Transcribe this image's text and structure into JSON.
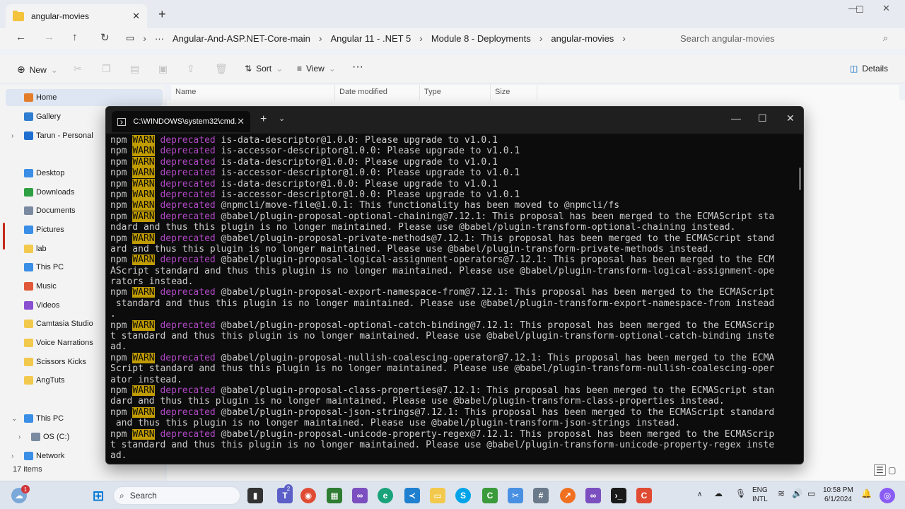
{
  "explorer": {
    "tab_title": "angular-movies",
    "breadcrumbs": [
      "Angular-And-ASP.NET-Core-main",
      "Angular 11 - .NET 5",
      "Module 8 - Deployments",
      "angular-movies"
    ],
    "search_placeholder": "Search angular-movies",
    "commands": {
      "new": "New",
      "sort": "Sort",
      "view": "View",
      "details": "Details"
    },
    "columns": [
      "Name",
      "Date modified",
      "Type",
      "Size"
    ],
    "sidebar": [
      "Home",
      "Gallery",
      "Tarun - Personal",
      "Desktop",
      "Downloads",
      "Documents",
      "Pictures",
      "lab",
      "This PC",
      "Music",
      "Videos",
      "Camtasia Studio",
      "Voice Narrations",
      "Scissors Kicks",
      "AngTuts",
      "This PC",
      "OS (C:)",
      "Network"
    ],
    "status": "17 items"
  },
  "terminal": {
    "tab_title": "C:\\WINDOWS\\system32\\cmd.",
    "lines": [
      [
        "npm",
        "WARN",
        "deprecated",
        " is-data-descriptor@1.0.0: Please upgrade to v1.0.1"
      ],
      [
        "npm",
        "WARN",
        "deprecated",
        " is-accessor-descriptor@1.0.0: Please upgrade to v1.0.1"
      ],
      [
        "npm",
        "WARN",
        "deprecated",
        " is-data-descriptor@1.0.0: Please upgrade to v1.0.1"
      ],
      [
        "npm",
        "WARN",
        "deprecated",
        " is-accessor-descriptor@1.0.0: Please upgrade to v1.0.1"
      ],
      [
        "npm",
        "WARN",
        "deprecated",
        " is-data-descriptor@1.0.0: Please upgrade to v1.0.1"
      ],
      [
        "npm",
        "WARN",
        "deprecated",
        " is-accessor-descriptor@1.0.0: Please upgrade to v1.0.1"
      ],
      [
        "npm",
        "WARN",
        "deprecated",
        " @npmcli/move-file@1.0.1: This functionality has been moved to @npmcli/fs"
      ],
      [
        "npm",
        "WARN",
        "deprecated",
        " @babel/plugin-proposal-optional-chaining@7.12.1: This proposal has been merged to the ECMAScript sta"
      ],
      [
        "",
        "",
        "",
        "ndard and thus this plugin is no longer maintained. Please use @babel/plugin-transform-optional-chaining instead."
      ],
      [
        "npm",
        "WARN",
        "deprecated",
        " @babel/plugin-proposal-private-methods@7.12.1: This proposal has been merged to the ECMAScript stand"
      ],
      [
        "",
        "",
        "",
        "ard and thus this plugin is no longer maintained. Please use @babel/plugin-transform-private-methods instead."
      ],
      [
        "npm",
        "WARN",
        "deprecated",
        " @babel/plugin-proposal-logical-assignment-operators@7.12.1: This proposal has been merged to the ECM"
      ],
      [
        "",
        "",
        "",
        "AScript standard and thus this plugin is no longer maintained. Please use @babel/plugin-transform-logical-assignment-ope"
      ],
      [
        "",
        "",
        "",
        "rators instead."
      ],
      [
        "npm",
        "WARN",
        "deprecated",
        " @babel/plugin-proposal-export-namespace-from@7.12.1: This proposal has been merged to the ECMAScript"
      ],
      [
        "",
        "",
        "",
        " standard and thus this plugin is no longer maintained. Please use @babel/plugin-transform-export-namespace-from instead"
      ],
      [
        "",
        "",
        "",
        "."
      ],
      [
        "npm",
        "WARN",
        "deprecated",
        " @babel/plugin-proposal-optional-catch-binding@7.12.1: This proposal has been merged to the ECMAScrip"
      ],
      [
        "",
        "",
        "",
        "t standard and thus this plugin is no longer maintained. Please use @babel/plugin-transform-optional-catch-binding inste"
      ],
      [
        "",
        "",
        "",
        "ad."
      ],
      [
        "npm",
        "WARN",
        "deprecated",
        " @babel/plugin-proposal-nullish-coalescing-operator@7.12.1: This proposal has been merged to the ECMA"
      ],
      [
        "",
        "",
        "",
        "Script standard and thus this plugin is no longer maintained. Please use @babel/plugin-transform-nullish-coalescing-oper"
      ],
      [
        "",
        "",
        "",
        "ator instead."
      ],
      [
        "npm",
        "WARN",
        "deprecated",
        " @babel/plugin-proposal-class-properties@7.12.1: This proposal has been merged to the ECMAScript stan"
      ],
      [
        "",
        "",
        "",
        "dard and thus this plugin is no longer maintained. Please use @babel/plugin-transform-class-properties instead."
      ],
      [
        "npm",
        "WARN",
        "deprecated",
        " @babel/plugin-proposal-json-strings@7.12.1: This proposal has been merged to the ECMAScript standard"
      ],
      [
        "",
        "",
        "",
        " and thus this plugin is no longer maintained. Please use @babel/plugin-transform-json-strings instead."
      ],
      [
        "npm",
        "WARN",
        "deprecated",
        " @babel/plugin-proposal-unicode-property-regex@7.12.1: This proposal has been merged to the ECMAScrip"
      ],
      [
        "",
        "",
        "",
        "t standard and thus this plugin is no longer maintained. Please use @babel/plugin-transform-unicode-property-regex inste"
      ],
      [
        "",
        "",
        "",
        "ad."
      ]
    ]
  },
  "taskbar": {
    "search": "Search",
    "badge": "1",
    "teams_badge": "2",
    "lang": "ENG",
    "layout": "INTL",
    "time": "10:58 PM",
    "date": "6/1/2024"
  }
}
